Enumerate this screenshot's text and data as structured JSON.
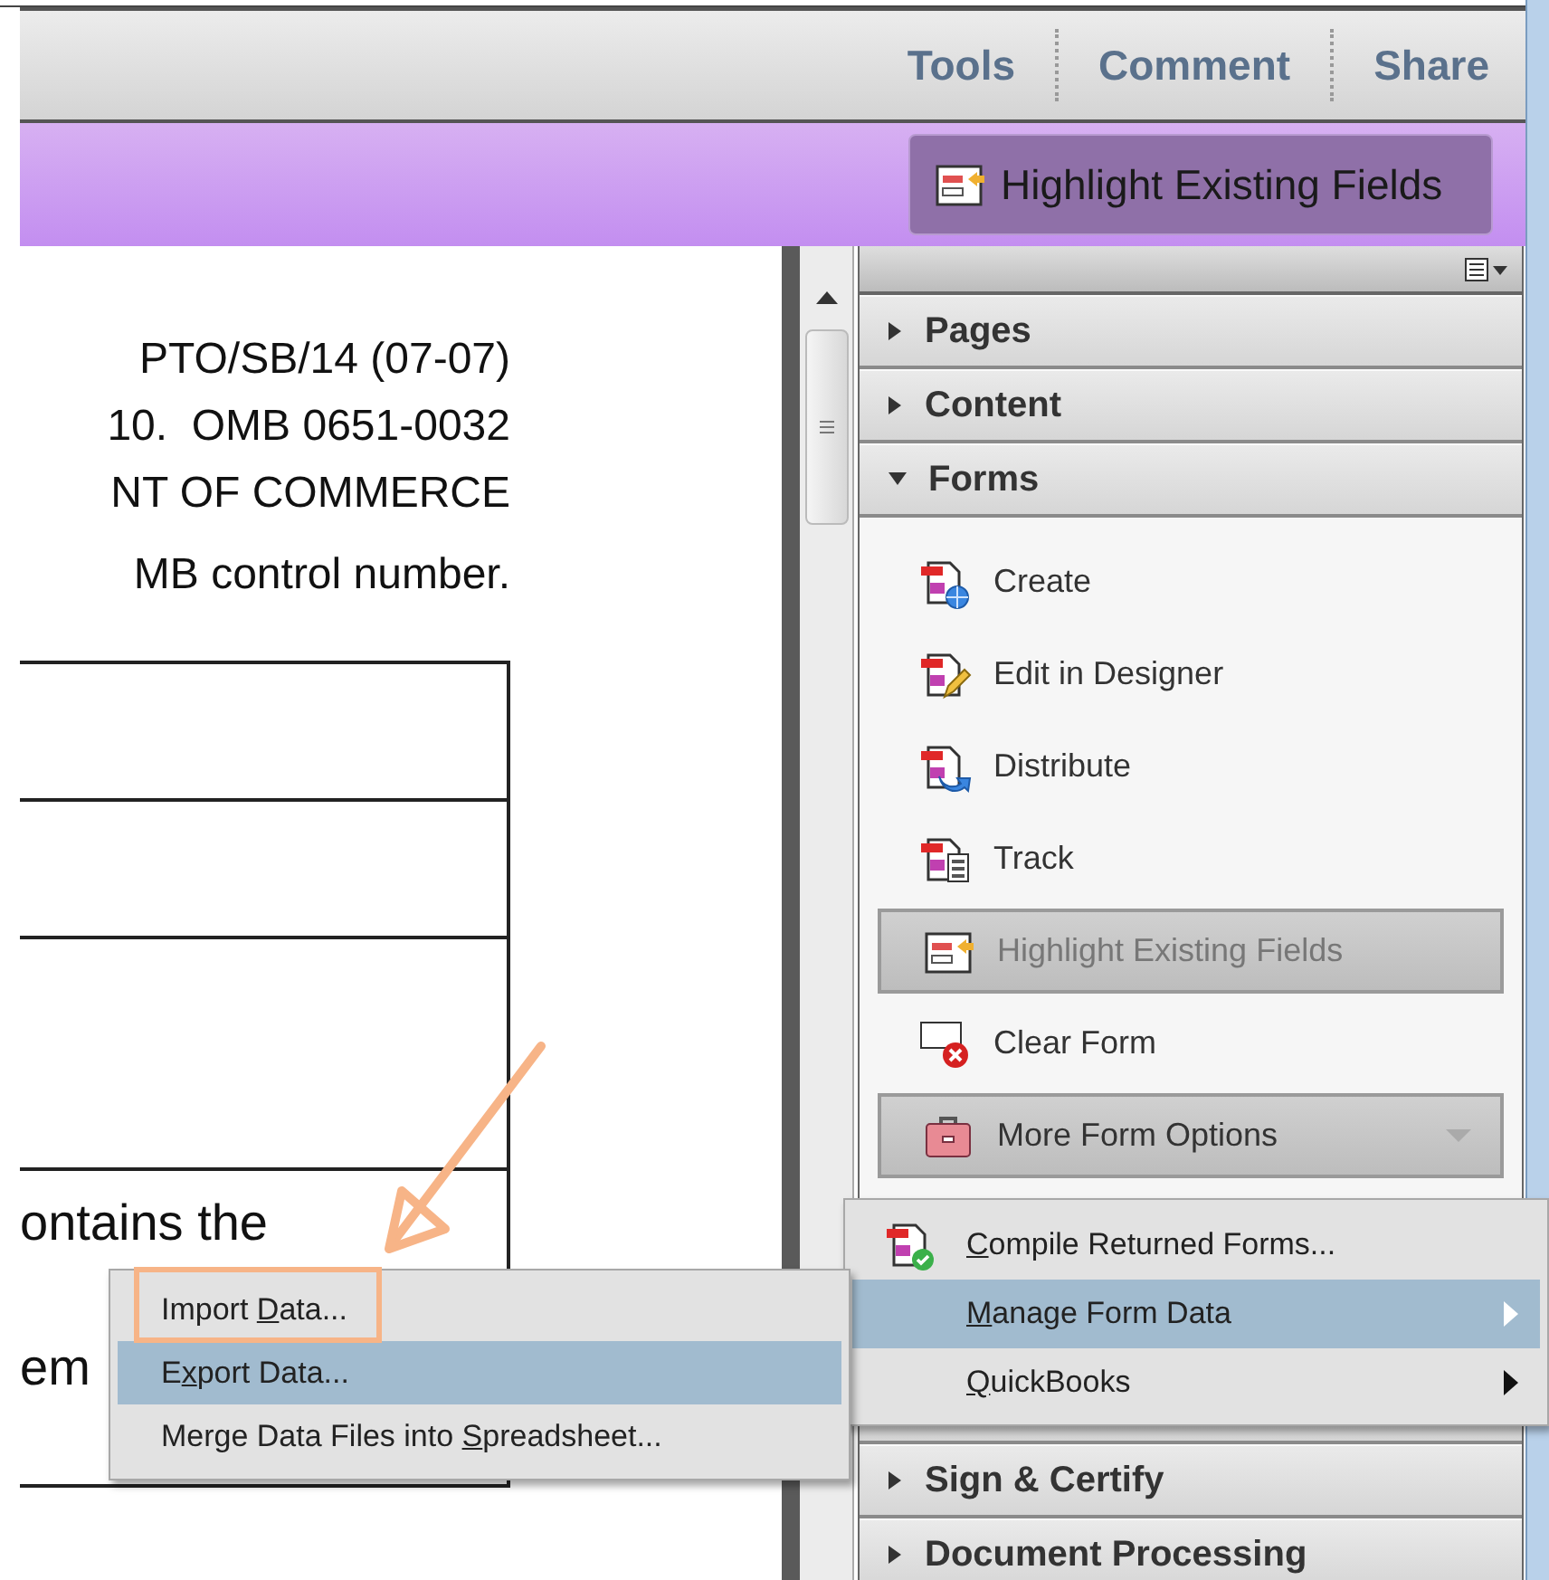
{
  "toolbar": {
    "tabs": [
      "Tools",
      "Comment",
      "Share"
    ]
  },
  "task_bar": {
    "button": "Highlight Existing Fields"
  },
  "document": {
    "header_lines": [
      "PTO/SB/14 (07-07)",
      "10.  OMB 0651-0032",
      "NT OF COMMERCE",
      "MB control number."
    ],
    "table_texts": [
      "ontains the",
      "em"
    ]
  },
  "panel": {
    "sections_top": [
      {
        "label": "Pages",
        "expanded": false
      },
      {
        "label": "Content",
        "expanded": false
      },
      {
        "label": "Forms",
        "expanded": true
      }
    ],
    "forms_items": [
      {
        "kind": "tool",
        "label": "Create"
      },
      {
        "kind": "tool",
        "label": "Edit in Designer"
      },
      {
        "kind": "tool",
        "label": "Distribute"
      },
      {
        "kind": "tool",
        "label": "Track"
      },
      {
        "kind": "button",
        "label": "Highlight Existing Fields"
      },
      {
        "kind": "tool",
        "label": "Clear Form"
      },
      {
        "kind": "dropdown",
        "label": "More Form Options"
      }
    ],
    "sections_bottom": [
      {
        "label": "Sign & Certify",
        "expanded": false
      },
      {
        "label": "Document Processing",
        "expanded": false
      }
    ]
  },
  "more_form_options_menu": [
    {
      "key": "C",
      "after": "ompile Returned Forms...",
      "submenu": false,
      "selected": false
    },
    {
      "key": "M",
      "after": "anage Form Data",
      "submenu": true,
      "selected": true
    },
    {
      "key": "Q",
      "after": "uickBooks",
      "submenu": true,
      "selected": false
    }
  ],
  "manage_form_data_menu": [
    {
      "before": "Import ",
      "key": "D",
      "after": "ata...",
      "selected": false
    },
    {
      "before": "E",
      "key": "x",
      "after": "port Data...",
      "selected": true
    },
    {
      "before": "Merge Data Files into ",
      "key": "S",
      "after": "preadsheet...",
      "selected": false
    }
  ]
}
